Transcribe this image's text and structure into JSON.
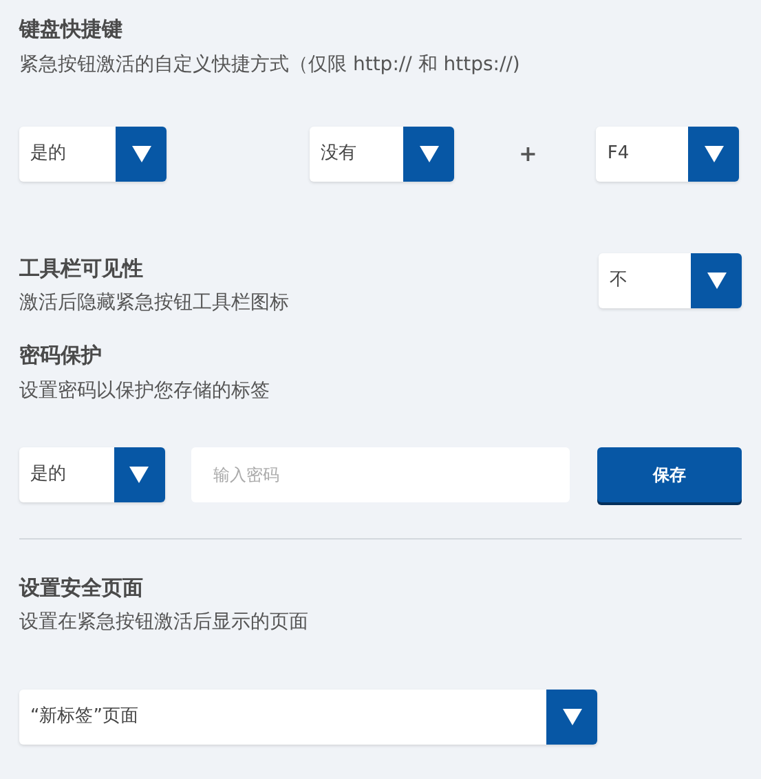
{
  "shortcut": {
    "title": "键盘快捷键",
    "description": "紧急按钮激活的自定义快捷方式（仅限 http:// 和 https://)",
    "dropdowns": [
      {
        "value": "是的"
      },
      {
        "value": "没有"
      },
      {
        "value": "F4"
      }
    ],
    "plus": "+"
  },
  "toolbar": {
    "title": "工具栏可见性",
    "description": "激活后隐藏紧急按钮工具栏图标",
    "dropdown": {
      "value": "不"
    }
  },
  "password": {
    "title": "密码保护",
    "description": "设置密码以保护您存储的标签",
    "dropdown": {
      "value": "是的"
    },
    "input": {
      "placeholder": "输入密码"
    },
    "save": "保存"
  },
  "safe_page": {
    "title": "设置安全页面",
    "description": "设置在紧急按钮激活后显示的页面",
    "dropdown": {
      "value": "“新标签”页面"
    }
  }
}
